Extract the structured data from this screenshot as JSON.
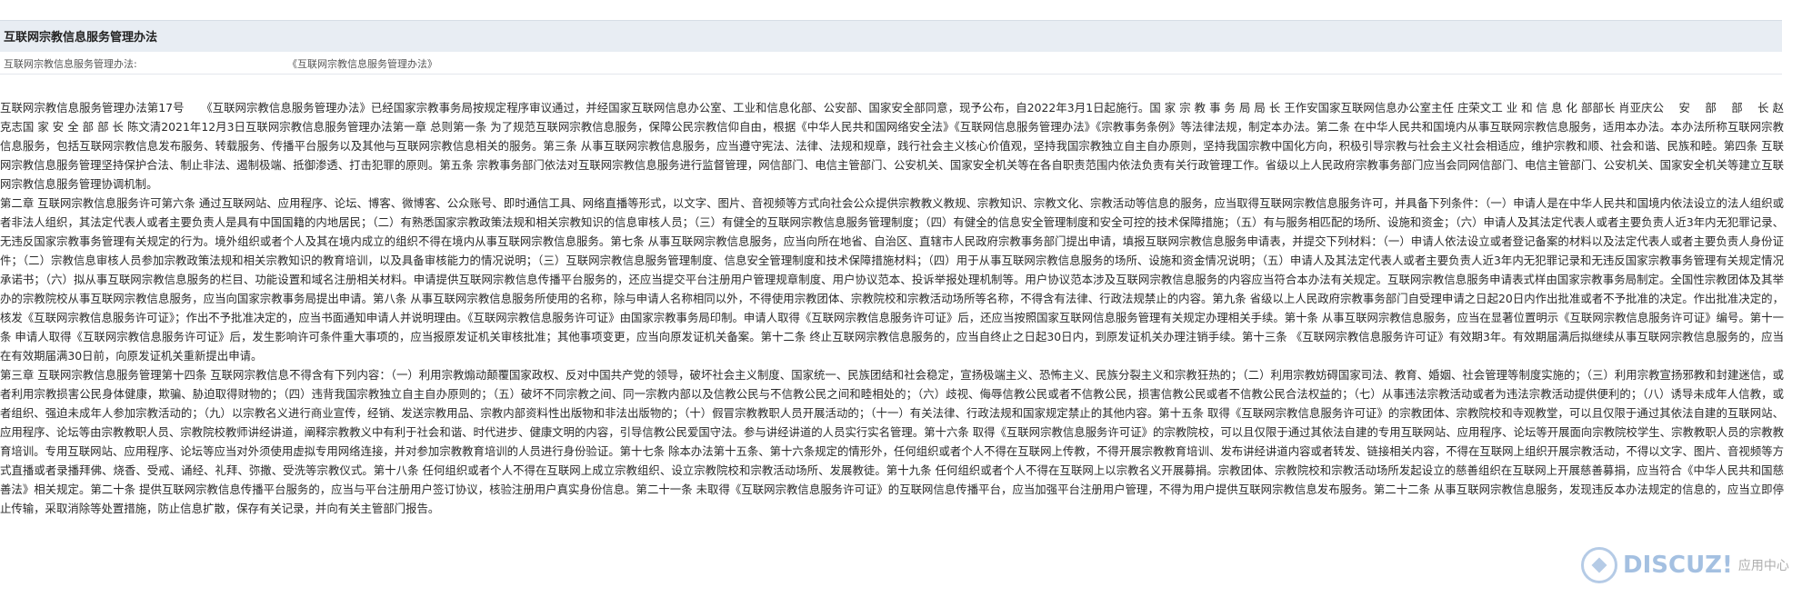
{
  "header": {
    "title": "互联网宗教信息服务管理办法"
  },
  "info_row": {
    "label": "互联网宗教信息服务管理办法:",
    "value": "《互联网宗教信息服务管理办法》"
  },
  "document": {
    "paragraphs": [
      "互联网宗教信息服务管理办法第17号　　《互联网宗教信息服务管理办法》已经国家宗教事务局按规定程序审议通过，并经国家互联网信息办公室、工业和信息化部、公安部、国家安全部同意，现予公布，自2022年3月1日起施行。国 家 宗 教 事 务 局 局 长 王作安国家互联网信息办公室主任 庄荣文工 业 和 信 息 化 部部长 肖亚庆公　 安　 部　 部　 长 赵克志国 家 安 全 部 部 长 陈文清2021年12月3日互联网宗教信息服务管理办法第一章 总则第一条 为了规范互联网宗教信息服务，保障公民宗教信仰自由，根据《中华人民共和国网络安全法》《互联网信息服务管理办法》《宗教事务条例》等法律法规，制定本办法。第二条 在中华人民共和国境内从事互联网宗教信息服务，适用本办法。本办法所称互联网宗教信息服务，包括互联网宗教信息发布服务、转载服务、传播平台服务以及其他与互联网宗教信息相关的服务。第三条 从事互联网宗教信息服务，应当遵守宪法、法律、法规和规章，践行社会主义核心价值观，坚持我国宗教独立自主自办原则，坚持我国宗教中国化方向，积极引导宗教与社会主义社会相适应，维护宗教和顺、社会和谐、民族和睦。第四条 互联网宗教信息服务管理坚持保护合法、制止非法、遏制极端、抵御渗透、打击犯罪的原则。第五条 宗教事务部门依法对互联网宗教信息服务进行监督管理，网信部门、电信主管部门、公安机关、国家安全机关等在各自职责范围内依法负责有关行政管理工作。省级以上人民政府宗教事务部门应当会同网信部门、电信主管部门、公安机关、国家安全机关等建立互联网宗教信息服务管理协调机制。",
      "第二章 互联网宗教信息服务许可第六条 通过互联网站、应用程序、论坛、博客、微博客、公众账号、即时通信工具、网络直播等形式，以文字、图片、音视频等方式向社会公众提供宗教教义教规、宗教知识、宗教文化、宗教活动等信息的服务，应当取得互联网宗教信息服务许可，并具备下列条件：（一）申请人是在中华人民共和国境内依法设立的法人组织或者非法人组织，其法定代表人或者主要负责人是具有中国国籍的内地居民；（二）有熟悉国家宗教政策法规和相关宗教知识的信息审核人员；（三）有健全的互联网宗教信息服务管理制度；（四）有健全的信息安全管理制度和安全可控的技术保障措施；（五）有与服务相匹配的场所、设施和资金；（六）申请人及其法定代表人或者主要负责人近3年内无犯罪记录、无违反国家宗教事务管理有关规定的行为。境外组织或者个人及其在境内成立的组织不得在境内从事互联网宗教信息服务。第七条 从事互联网宗教信息服务，应当向所在地省、自治区、直辖市人民政府宗教事务部门提出申请，填报互联网宗教信息服务申请表，并提交下列材料：（一）申请人依法设立或者登记备案的材料以及法定代表人或者主要负责人身份证件；（二）宗教信息审核人员参加宗教政策法规和相关宗教知识的教育培训，以及具备审核能力的情况说明；（三）互联网宗教信息服务管理制度、信息安全管理制度和技术保障措施材料；（四）用于从事互联网宗教信息服务的场所、设施和资金情况说明；（五）申请人及其法定代表人或者主要负责人近3年内无犯罪记录和无违反国家宗教事务管理有关规定情况承诺书；（六）拟从事互联网宗教信息服务的栏目、功能设置和域名注册相关材料。申请提供互联网宗教信息传播平台服务的，还应当提交平台注册用户管理规章制度、用户协议范本、投诉举报处理机制等。用户协议范本涉及互联网宗教信息服务的内容应当符合本办法有关规定。互联网宗教信息服务申请表式样由国家宗教事务局制定。全国性宗教团体及其举办的宗教院校从事互联网宗教信息服务，应当向国家宗教事务局提出申请。第八条 从事互联网宗教信息服务所使用的名称，除与申请人名称相同以外，不得使用宗教团体、宗教院校和宗教活动场所等名称，不得含有法律、行政法规禁止的内容。第九条 省级以上人民政府宗教事务部门自受理申请之日起20日内作出批准或者不予批准的决定。作出批准决定的，核发《互联网宗教信息服务许可证》；作出不予批准决定的，应当书面通知申请人并说明理由。《互联网宗教信息服务许可证》由国家宗教事务局印制。申请人取得《互联网宗教信息服务许可证》后，还应当按照国家互联网信息服务管理有关规定办理相关手续。第十条 从事互联网宗教信息服务，应当在显著位置明示《互联网宗教信息服务许可证》编号。第十一条 申请人取得《互联网宗教信息服务许可证》后，发生影响许可条件重大事项的，应当报原发证机关审核批准；其他事项变更，应当向原发证机关备案。第十二条 终止互联网宗教信息服务的，应当自终止之日起30日内，到原发证机关办理注销手续。第十三条 《互联网宗教信息服务许可证》有效期3年。有效期届满后拟继续从事互联网宗教信息服务的，应当在有效期届满30日前，向原发证机关重新提出申请。",
      "第三章 互联网宗教信息服务管理第十四条 互联网宗教信息不得含有下列内容：（一）利用宗教煽动颠覆国家政权、反对中国共产党的领导，破坏社会主义制度、国家统一、民族团结和社会稳定，宣扬极端主义、恐怖主义、民族分裂主义和宗教狂热的；（二）利用宗教妨碍国家司法、教育、婚姻、社会管理等制度实施的；（三）利用宗教宣扬邪教和封建迷信，或者利用宗教损害公民身体健康，欺骗、胁迫取得财物的；（四）违背我国宗教独立自主自办原则的；（五）破坏不同宗教之间、同一宗教内部以及信教公民与不信教公民之间和睦相处的；（六）歧视、侮辱信教公民或者不信教公民，损害信教公民或者不信教公民合法权益的；（七）从事违法宗教活动或者为违法宗教活动提供便利的；（八）诱导未成年人信教，或者组织、强迫未成年人参加宗教活动的；（九）以宗教名义进行商业宣传，经销、发送宗教用品、宗教内部资料性出版物和非法出版物的；（十）假冒宗教教职人员开展活动的；（十一）有关法律、行政法规和国家规定禁止的其他内容。第十五条 取得《互联网宗教信息服务许可证》的宗教团体、宗教院校和寺观教堂，可以且仅限于通过其依法自建的互联网站、应用程序、论坛等由宗教教职人员、宗教院校教师讲经讲道，阐释宗教教义中有利于社会和谐、时代进步、健康文明的内容，引导信教公民爱国守法。参与讲经讲道的人员实行实名管理。第十六条 取得《互联网宗教信息服务许可证》的宗教院校，可以且仅限于通过其依法自建的专用互联网站、应用程序、论坛等开展面向宗教院校学生、宗教教职人员的宗教教育培训。专用互联网站、应用程序、论坛等应当对外须使用虚拟专用网络连接，并对参加宗教教育培训的人员进行身份验证。第十七条 除本办法第十五条、第十六条规定的情形外，任何组织或者个人不得在互联网上传教，不得开展宗教教育培训、发布讲经讲道内容或者转发、链接相关内容，不得在互联网上组织开展宗教活动，不得以文字、图片、音视频等方式直播或者录播拜佛、烧香、受戒、诵经、礼拜、弥撒、受洗等宗教仪式。第十八条 任何组织或者个人不得在互联网上成立宗教组织、设立宗教院校和宗教活动场所、发展教徒。第十九条 任何组织或者个人不得在互联网上以宗教名义开展募捐。宗教团体、宗教院校和宗教活动场所发起设立的慈善组织在互联网上开展慈善募捐，应当符合《中华人民共和国慈善法》相关规定。第二十条 提供互联网宗教信息传播平台服务的，应当与平台注册用户签订协议，核验注册用户真实身份信息。第二十一条 未取得《互联网宗教信息服务许可证》的互联网信息传播平台，应当加强平台注册用户管理，不得为用户提供互联网宗教信息发布服务。第二十二条 从事互联网宗教信息服务，发现违反本办法规定的信息的，应当立即停止传输，采取消除等处置措施，防止信息扩散，保存有关记录，并向有关主管部门报告。"
    ]
  },
  "watermark": {
    "brand": "DISCUZ!",
    "sub": "应用中心"
  },
  "colors": {
    "header_band": "#e8edf3",
    "text": "#2b2b2b"
  }
}
